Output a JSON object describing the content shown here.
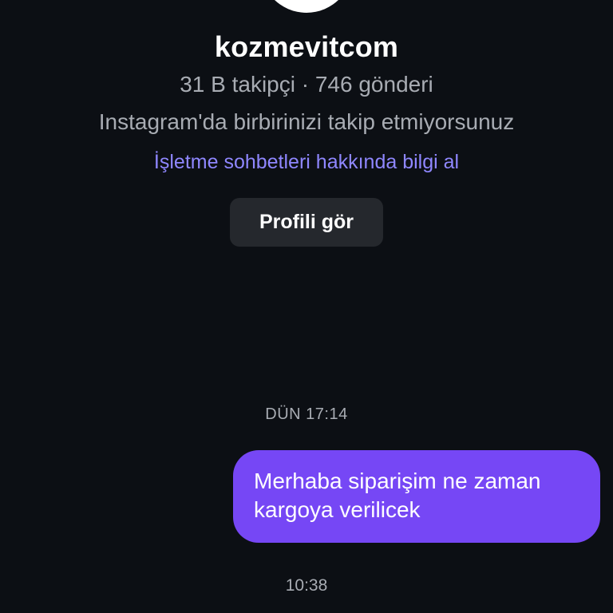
{
  "profile": {
    "username": "kozmevitcom",
    "stats": "31 B takipçi · 746 gönderi",
    "follow_status": "Instagram'da birbirinizi takip etmiyorsunuz",
    "business_info_link": "İşletme sohbetleri hakkında bilgi al",
    "view_profile_label": "Profili gör"
  },
  "chat": {
    "timestamp_1": "DÜN 17:14",
    "messages": [
      {
        "sender": "me",
        "lines": [
          "Merhaba siparişim ne zaman",
          "kargoya verilicek"
        ]
      }
    ],
    "timestamp_2": "10:38"
  },
  "colors": {
    "background": "#0c0f14",
    "outgoing_bubble": "#7647f5",
    "link": "#8f87ff",
    "muted_text": "#a8acb3",
    "button_bg": "#25282d"
  }
}
